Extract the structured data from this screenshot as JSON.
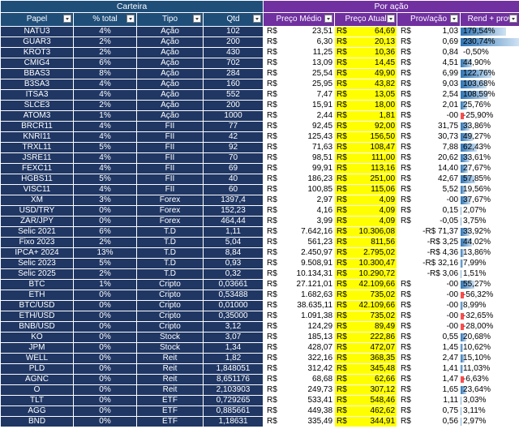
{
  "groups": {
    "carteira": "Carteira",
    "por_acao": "Por ação"
  },
  "headers": {
    "papel": "Papel",
    "pct_total": "% total",
    "tipo": "Tipo",
    "qtd": "Qtd",
    "preco_medio": "Preço Médio",
    "preco_atual": "Preço Atual",
    "prov_acao": "Prov/ação",
    "rend_prov": "Rend + prov"
  },
  "currency": "R$",
  "rows": [
    {
      "papel": "NATU3",
      "pct": "4%",
      "tipo": "Ação",
      "qtd": "102",
      "pm": "23,51",
      "pa": "64,69",
      "prov": "1,03",
      "rend": "179,54%",
      "rend_value": 179.54
    },
    {
      "papel": "GUAR3",
      "pct": "2%",
      "tipo": "Ação",
      "qtd": "200",
      "pm": "6,30",
      "pa": "20,13",
      "prov": "0,69",
      "rend": "230,74%",
      "rend_value": 230.74
    },
    {
      "papel": "KROT3",
      "pct": "2%",
      "tipo": "Ação",
      "qtd": "430",
      "pm": "11,25",
      "pa": "10,36",
      "prov": "0,84",
      "rend": "-0,50%",
      "rend_value": -0.5
    },
    {
      "papel": "CMIG4",
      "pct": "6%",
      "tipo": "Ação",
      "qtd": "702",
      "pm": "13,09",
      "pa": "14,45",
      "prov": "4,51",
      "rend": "44,90%",
      "rend_value": 44.9
    },
    {
      "papel": "BBAS3",
      "pct": "8%",
      "tipo": "Ação",
      "qtd": "284",
      "pm": "25,54",
      "pa": "49,90",
      "prov": "6,99",
      "rend": "122,76%",
      "rend_value": 122.76
    },
    {
      "papel": "B3SA3",
      "pct": "4%",
      "tipo": "Ação",
      "qtd": "160",
      "pm": "25,95",
      "pa": "43,82",
      "prov": "9,03",
      "rend": "103,68%",
      "rend_value": 103.68
    },
    {
      "papel": "ITSA3",
      "pct": "4%",
      "tipo": "Ação",
      "qtd": "552",
      "pm": "7,47",
      "pa": "13,05",
      "prov": "2,54",
      "rend": "108,59%",
      "rend_value": 108.59
    },
    {
      "papel": "SLCE3",
      "pct": "2%",
      "tipo": "Ação",
      "qtd": "200",
      "pm": "15,91",
      "pa": "18,00",
      "prov": "2,01",
      "rend": "25,76%",
      "rend_value": 25.76
    },
    {
      "papel": "ATOM3",
      "pct": "1%",
      "tipo": "Ação",
      "qtd": "1000",
      "pm": "2,44",
      "pa": "1,81",
      "prov": "-00",
      "rend": "-25,90%",
      "rend_value": -25.9
    },
    {
      "papel": "BRCR11",
      "pct": "4%",
      "tipo": "FII",
      "qtd": "77",
      "pm": "92,45",
      "pa": "92,00",
      "prov": "31,75",
      "rend": "33,86%",
      "rend_value": 33.86
    },
    {
      "papel": "KNRI11",
      "pct": "4%",
      "tipo": "FII",
      "qtd": "42",
      "pm": "125,43",
      "pa": "156,50",
      "prov": "30,73",
      "rend": "49,27%",
      "rend_value": 49.27
    },
    {
      "papel": "TRXL11",
      "pct": "5%",
      "tipo": "FII",
      "qtd": "92",
      "pm": "71,63",
      "pa": "108,47",
      "prov": "7,88",
      "rend": "62,43%",
      "rend_value": 62.43
    },
    {
      "papel": "JSRE11",
      "pct": "4%",
      "tipo": "FII",
      "qtd": "70",
      "pm": "98,51",
      "pa": "111,00",
      "prov": "20,62",
      "rend": "33,61%",
      "rend_value": 33.61
    },
    {
      "papel": "FEXC11",
      "pct": "4%",
      "tipo": "FII",
      "qtd": "69",
      "pm": "99,91",
      "pa": "113,16",
      "prov": "14,40",
      "rend": "27,67%",
      "rend_value": 27.67
    },
    {
      "papel": "HGBS11",
      "pct": "5%",
      "tipo": "FII",
      "qtd": "40",
      "pm": "186,23",
      "pa": "251,00",
      "prov": "42,67",
      "rend": "57,85%",
      "rend_value": 57.85
    },
    {
      "papel": "VISC11",
      "pct": "4%",
      "tipo": "FII",
      "qtd": "60",
      "pm": "100,85",
      "pa": "115,06",
      "prov": "5,52",
      "rend": "19,56%",
      "rend_value": 19.56
    },
    {
      "papel": "XM",
      "pct": "3%",
      "tipo": "Forex",
      "qtd": "1397,4",
      "pm": "2,97",
      "pa": "4,09",
      "prov": "-00",
      "rend": "37,67%",
      "rend_value": 37.67
    },
    {
      "papel": "USD/TRY",
      "pct": "0%",
      "tipo": "Forex",
      "qtd": "152,23",
      "pm": "4,16",
      "pa": "4,09",
      "prov": "0,15",
      "rend": "2,07%",
      "rend_value": 2.07
    },
    {
      "papel": "ZAR/JPY",
      "pct": "0%",
      "tipo": "Forex",
      "qtd": "464,44",
      "pm": "3,99",
      "pa": "4,09",
      "prov": "-0,05",
      "rend": "3,75%",
      "rend_value": 3.75
    },
    {
      "papel": "Selic 2021",
      "pct": "6%",
      "tipo": "T.D",
      "qtd": "1,11",
      "pm": "7.642,16",
      "pa": "10.306,08",
      "prov": "-R$ 71,37",
      "rend": "33,92%",
      "rend_value": 33.92
    },
    {
      "papel": "Fixo 2023",
      "pct": "2%",
      "tipo": "T.D",
      "qtd": "5,04",
      "pm": "561,23",
      "pa": "811,56",
      "prov": "-R$ 3,25",
      "rend": "44,02%",
      "rend_value": 44.02
    },
    {
      "papel": "IPCA+ 2024",
      "pct": "13%",
      "tipo": "T.D",
      "qtd": "8,84",
      "pm": "2.450,97",
      "pa": "2.795,02",
      "prov": "-R$ 4,36",
      "rend": "13,86%",
      "rend_value": 13.86
    },
    {
      "papel": "Selic 2023",
      "pct": "5%",
      "tipo": "T.D",
      "qtd": "0,93",
      "pm": "9.508,91",
      "pa": "10.300,47",
      "prov": "-R$ 32,16",
      "rend": "7,99%",
      "rend_value": 7.99
    },
    {
      "papel": "Selic 2025",
      "pct": "2%",
      "tipo": "T.D",
      "qtd": "0,32",
      "pm": "10.134,31",
      "pa": "10.290,72",
      "prov": "-R$ 3,06",
      "rend": "1,51%",
      "rend_value": 1.51
    },
    {
      "papel": "BTC",
      "pct": "1%",
      "tipo": "Cripto",
      "qtd": "0,03661",
      "pm": "27.121,01",
      "pa": "42.109,66",
      "prov": "-00",
      "rend": "55,27%",
      "rend_value": 55.27
    },
    {
      "papel": "ETH",
      "pct": "0%",
      "tipo": "Cripto",
      "qtd": "0,53488",
      "pm": "1.682,63",
      "pa": "735,02",
      "prov": "-00",
      "rend": "-56,32%",
      "rend_value": -56.32
    },
    {
      "papel": "BTC/USD",
      "pct": "0%",
      "tipo": "Cripto",
      "qtd": "0,01000",
      "pm": "38.635,11",
      "pa": "42.109,66",
      "prov": "-00",
      "rend": "8,99%",
      "rend_value": 8.99
    },
    {
      "papel": "ETH/USD",
      "pct": "0%",
      "tipo": "Cripto",
      "qtd": "0,35000",
      "pm": "1.091,38",
      "pa": "735,02",
      "prov": "-00",
      "rend": "-32,65%",
      "rend_value": -32.65
    },
    {
      "papel": "BNB/USD",
      "pct": "0%",
      "tipo": "Cripto",
      "qtd": "3,12",
      "pm": "124,29",
      "pa": "89,49",
      "prov": "-00",
      "rend": "-28,00%",
      "rend_value": -28.0
    },
    {
      "papel": "KO",
      "pct": "0%",
      "tipo": "Stock",
      "qtd": "3,07",
      "pm": "185,13",
      "pa": "222,86",
      "prov": "0,55",
      "rend": "20,68%",
      "rend_value": 20.68
    },
    {
      "papel": "JPM",
      "pct": "0%",
      "tipo": "Stock",
      "qtd": "1,34",
      "pm": "428,07",
      "pa": "472,07",
      "prov": "1,45",
      "rend": "10,62%",
      "rend_value": 10.62
    },
    {
      "papel": "WELL",
      "pct": "0%",
      "tipo": "Reit",
      "qtd": "1,82",
      "pm": "322,16",
      "pa": "368,35",
      "prov": "2,47",
      "rend": "15,10%",
      "rend_value": 15.1
    },
    {
      "papel": "PLD",
      "pct": "0%",
      "tipo": "Reit",
      "qtd": "1,848051",
      "pm": "312,42",
      "pa": "345,48",
      "prov": "1,41",
      "rend": "11,03%",
      "rend_value": 11.03
    },
    {
      "papel": "AGNC",
      "pct": "0%",
      "tipo": "Reit",
      "qtd": "8,651176",
      "pm": "68,68",
      "pa": "62,66",
      "prov": "1,47",
      "rend": "-6,63%",
      "rend_value": -6.63
    },
    {
      "papel": "O",
      "pct": "0%",
      "tipo": "Reit",
      "qtd": "2,103903",
      "pm": "249,73",
      "pa": "307,12",
      "prov": "1,65",
      "rend": "23,64%",
      "rend_value": 23.64
    },
    {
      "papel": "TLT",
      "pct": "0%",
      "tipo": "ETF",
      "qtd": "0,729265",
      "pm": "533,41",
      "pa": "548,46",
      "prov": "1,11",
      "rend": "3,03%",
      "rend_value": 3.03
    },
    {
      "papel": "AGG",
      "pct": "0%",
      "tipo": "ETF",
      "qtd": "0,885661",
      "pm": "449,38",
      "pa": "462,62",
      "prov": "0,75",
      "rend": "3,11%",
      "rend_value": 3.11
    },
    {
      "papel": "BND",
      "pct": "0%",
      "tipo": "ETF",
      "qtd": "1,18631",
      "pm": "335,49",
      "pa": "344,91",
      "prov": "0,56",
      "rend": "2,97%",
      "rend_value": 2.97
    }
  ]
}
